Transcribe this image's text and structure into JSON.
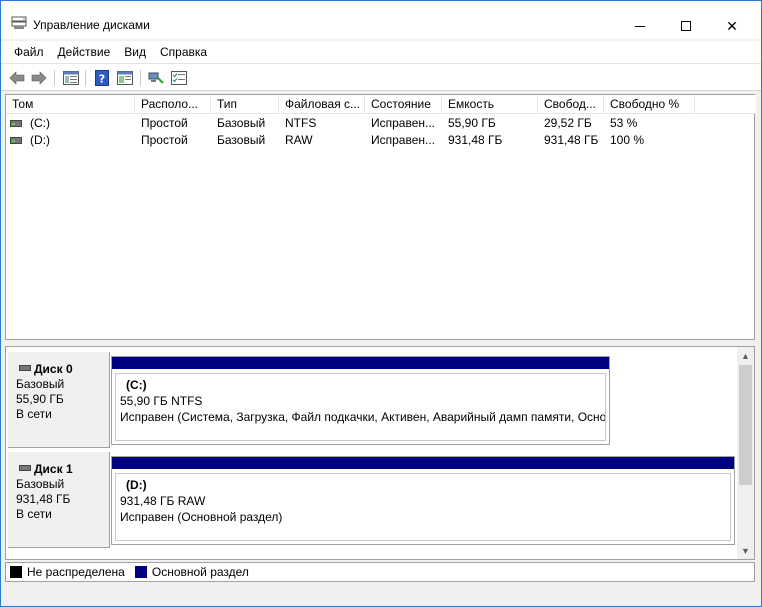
{
  "window": {
    "title": "Управление дисками",
    "controls": {
      "minimize": "minimize",
      "maximize": "maximize",
      "close": "✕"
    }
  },
  "menu": [
    "Файл",
    "Действие",
    "Вид",
    "Справка"
  ],
  "toolbar": {
    "icons": [
      "back-arrow-icon",
      "forward-arrow-icon",
      "properties-icon",
      "help-icon",
      "console-icon",
      "connect-icon",
      "checklist-icon"
    ]
  },
  "volume_list": {
    "columns": [
      "Том",
      "Располо...",
      "Тип",
      "Файловая с...",
      "Состояние",
      "Емкость",
      "Свобод...",
      "Свободно %"
    ],
    "rows": [
      [
        "(C:)",
        "Простой",
        "Базовый",
        "NTFS",
        "Исправен...",
        "55,90 ГБ",
        "29,52 ГБ",
        "53 %"
      ],
      [
        "(D:)",
        "Простой",
        "Базовый",
        "RAW",
        "Исправен...",
        "931,48 ГБ",
        "931,48 ГБ",
        "100 %"
      ]
    ]
  },
  "disks": [
    {
      "name": "Диск 0",
      "type": "Базовый",
      "size": "55,90 ГБ",
      "status": "В сети",
      "partition": {
        "title": "(C:)",
        "size_fs": "55,90 ГБ NTFS",
        "status": "Исправен (Система, Загрузка, Файл подкачки, Активен, Аварийный дамп памяти, Осно"
      }
    },
    {
      "name": "Диск 1",
      "type": "Базовый",
      "size": "931,48 ГБ",
      "status": "В сети",
      "partition": {
        "title": "(D:)",
        "size_fs": "931,48 ГБ RAW",
        "status": "Исправен (Основной раздел)"
      }
    }
  ],
  "legend": [
    {
      "label": "Не распределена",
      "color": "#000000"
    },
    {
      "label": "Основной раздел",
      "color": "#000080"
    }
  ],
  "colors": {
    "primary_partition": "#000080",
    "unallocated": "#000000",
    "accent": "#2b7bd6"
  }
}
